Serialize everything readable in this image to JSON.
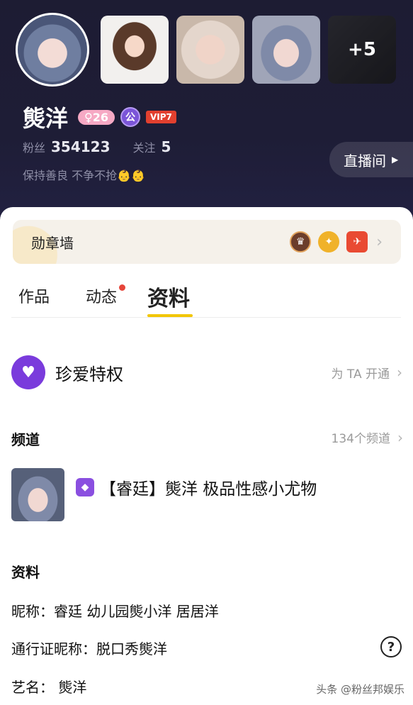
{
  "profile": {
    "name": "熋洋",
    "age_badge": "♀26",
    "gong_badge": "公",
    "vip_badge": "VIP7",
    "fans_label": "粉丝",
    "fans_count": "354123",
    "follow_label": "关注",
    "follow_count": "5",
    "bio": "保持善良  不争不抢👶👶",
    "more_photos": "+5",
    "live_button": "直播间"
  },
  "medal_wall": {
    "title": "勋章墙"
  },
  "tabs": {
    "works": "作品",
    "dynamics": "动态",
    "profile": "资料"
  },
  "privilege": {
    "title": "珍爱特权",
    "action": "为 TA 开通"
  },
  "channel": {
    "title": "频道",
    "count": "134个频道",
    "item_name": "【睿廷】熋洋 极品性感小尤物"
  },
  "info": {
    "title": "资料",
    "nickname": "昵称：睿廷 幼儿园熋小洋 居居洋",
    "pass_nickname": "通行证昵称：脱口秀熋洋",
    "stage_name": "艺名：  熋洋",
    "help": "?"
  },
  "watermark": "头条 @粉丝邦娱乐",
  "colors": {
    "hero_bg": "#1e1d36",
    "tab_underline": "#f2c600",
    "privilege_purple": "#7a3bdc",
    "vip_red": "#e2402f"
  }
}
